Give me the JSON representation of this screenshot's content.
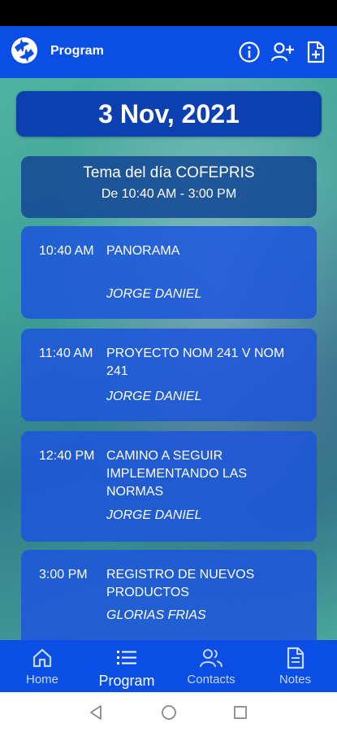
{
  "app_bar": {
    "title": "Program",
    "actions": [
      "info-icon",
      "add-user-icon",
      "add-document-icon"
    ]
  },
  "date": "3 Nov, 2021",
  "topic": {
    "title": "Tema del día COFEPRIS",
    "time": "De 10:40 AM - 3:00 PM"
  },
  "sessions": [
    {
      "time": "10:40 AM",
      "title": "PANORAMA",
      "speaker": "JORGE DANIEL"
    },
    {
      "time": "11:40 AM",
      "title": "PROYECTO NOM 241 V NOM 241",
      "speaker": "JORGE DANIEL"
    },
    {
      "time": "12:40 PM",
      "title": "CAMINO A SEGUIR IMPLEMENTANDO LAS NORMAS",
      "speaker": "JORGE DANIEL"
    },
    {
      "time": "3:00 PM",
      "title": "REGISTRO DE NUEVOS PRODUCTOS",
      "speaker": "GLORIAS FRIAS"
    }
  ],
  "bottom_nav": [
    {
      "label": "Home",
      "icon": "home-icon",
      "active": false
    },
    {
      "label": "Program",
      "icon": "list-icon",
      "active": true
    },
    {
      "label": "Contacts",
      "icon": "contacts-icon",
      "active": false
    },
    {
      "label": "Notes",
      "icon": "notes-icon",
      "active": false
    }
  ],
  "colors": {
    "primary": "#0a4ee6",
    "date_banner": "#0c3fb0",
    "card": "#1c55dc"
  }
}
